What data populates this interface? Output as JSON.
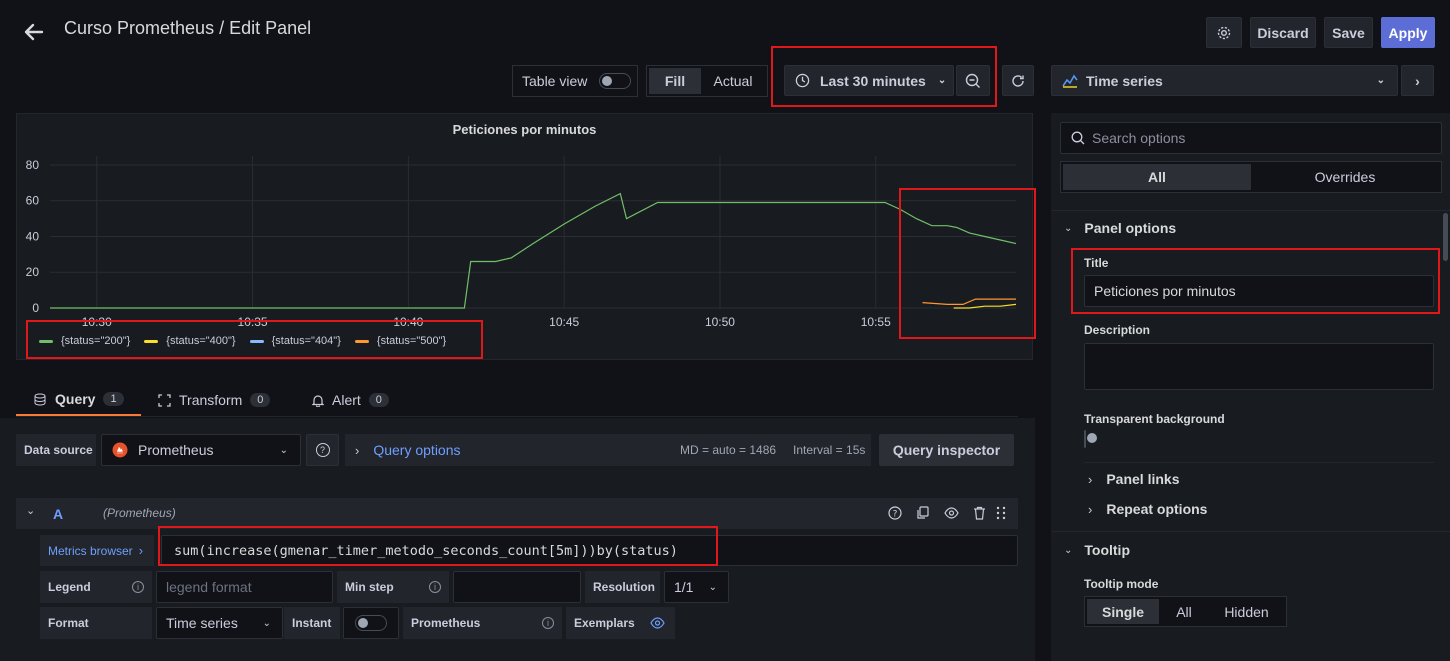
{
  "header": {
    "title": "Curso Prometheus / Edit Panel",
    "discard_label": "Discard",
    "save_label": "Save",
    "apply_label": "Apply"
  },
  "toolbar": {
    "table_view_label": "Table view",
    "fill_label": "Fill",
    "actual_label": "Actual",
    "time_range_label": "Last 30 minutes"
  },
  "viz_picker": {
    "label": "Time series"
  },
  "panel": {
    "title": "Peticiones por minutos",
    "legend": [
      {
        "label": "{status=\"200\"}",
        "color": "#73bf69"
      },
      {
        "label": "{status=\"400\"}",
        "color": "#fade2a"
      },
      {
        "label": "{status=\"404\"}",
        "color": "#8ab8ff"
      },
      {
        "label": "{status=\"500\"}",
        "color": "#ff9830"
      }
    ]
  },
  "chart_data": {
    "type": "line",
    "title": "Peticiones por minutos",
    "x_ticks": [
      "10:30",
      "10:35",
      "10:40",
      "10:45",
      "10:50",
      "10:55"
    ],
    "y_ticks": [
      0,
      20,
      40,
      60,
      80
    ],
    "ylim": [
      0,
      85
    ],
    "x_range_minutes": [
      28.5,
      59.5
    ],
    "grid": true,
    "legend_position": "bottom-left",
    "series": [
      {
        "name": "{status=\"200\"}",
        "color": "#73bf69",
        "x": [
          28.5,
          41.8,
          42.0,
          42.8,
          43.3,
          44.0,
          45.0,
          46.0,
          46.8,
          47.0,
          48.0,
          49.0,
          50.0,
          51.0,
          52.0,
          53.0,
          54.0,
          55.0,
          55.3,
          55.8,
          56.3,
          56.8,
          57.3,
          57.6,
          58.0,
          58.5,
          59.0,
          59.5
        ],
        "y": [
          0,
          0,
          26,
          26,
          28,
          36,
          47,
          57,
          64,
          50,
          59,
          59,
          59,
          59,
          59,
          59,
          59,
          59,
          59,
          55,
          50,
          46,
          46,
          45,
          42,
          40,
          38,
          36
        ]
      },
      {
        "name": "{status=\"400\"}",
        "color": "#fade2a",
        "x": [
          57.5,
          58.0,
          58.5,
          59.0,
          59.5
        ],
        "y": [
          0,
          0,
          1,
          1,
          2
        ]
      },
      {
        "name": "{status=\"404\"}",
        "color": "#8ab8ff",
        "x": [],
        "y": []
      },
      {
        "name": "{status=\"500\"}",
        "color": "#ff9830",
        "x": [
          56.5,
          57.3,
          57.8,
          58.2,
          58.6,
          59.0,
          59.5
        ],
        "y": [
          3,
          2,
          2,
          5,
          5,
          5,
          5
        ]
      }
    ]
  },
  "query_tabs": [
    {
      "label": "Query",
      "count": "1"
    },
    {
      "label": "Transform",
      "count": "0"
    },
    {
      "label": "Alert",
      "count": "0"
    }
  ],
  "datasource": {
    "label": "Data source",
    "name": "Prometheus",
    "query_options_label": "Query options",
    "md_label": "MD = auto = 1486",
    "interval_label": "Interval = 15s",
    "inspector_label": "Query inspector"
  },
  "query": {
    "ref_id": "A",
    "ds_name": "(Prometheus)",
    "metrics_browser_label": "Metrics browser",
    "expression": "sum(increase(gmenar_timer_metodo_seconds_count[5m]))by(status)",
    "legend_label": "Legend",
    "legend_placeholder": "legend format",
    "min_step_label": "Min step",
    "resolution_label": "Resolution",
    "resolution_value": "1/1",
    "format_label": "Format",
    "format_value": "Time series",
    "instant_label": "Instant",
    "prometheus_label": "Prometheus",
    "exemplars_label": "Exemplars"
  },
  "options_pane": {
    "search_placeholder": "Search options",
    "tab_all": "All",
    "tab_overrides": "Overrides",
    "panel_options_label": "Panel options",
    "title_label": "Title",
    "title_value": "Peticiones por minutos",
    "description_label": "Description",
    "transparent_label": "Transparent background",
    "panel_links_label": "Panel links",
    "repeat_options_label": "Repeat options",
    "tooltip_label": "Tooltip",
    "tooltip_mode_label": "Tooltip mode",
    "tooltip_modes": [
      "Single",
      "All",
      "Hidden"
    ]
  },
  "colors": {
    "accent": "#5c6dd6",
    "link": "#6e9fff",
    "highlight": "#e0171b"
  }
}
